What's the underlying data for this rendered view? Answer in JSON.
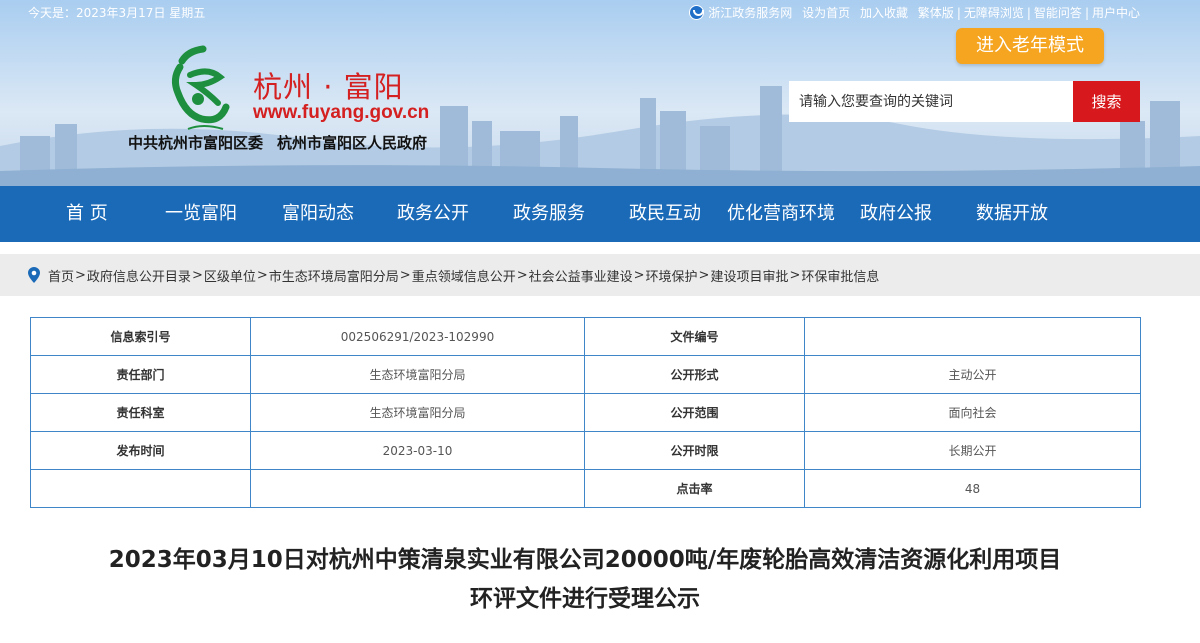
{
  "topbar": {
    "date": "今天是：2023年3月17日 星期五",
    "links": [
      "浙江政务服务网",
      "设为首页",
      "加入收藏",
      "繁体版",
      "无障碍浏览",
      "智能问答",
      "用户中心"
    ]
  },
  "elder_mode": "进入老年模式",
  "logo": {
    "title": "杭州 · 富阳",
    "url": "www.fuyang.gov.cn",
    "org1": "中共杭州市富阳区委",
    "org2": "杭州市富阳区人民政府"
  },
  "search": {
    "placeholder": "请输入您要查询的关键词",
    "button": "搜索"
  },
  "nav": [
    "首 页",
    "一览富阳",
    "富阳动态",
    "政务公开",
    "政务服务",
    "政民互动",
    "优化营商环境",
    "政府公报",
    "数据开放"
  ],
  "breadcrumb": [
    "首页",
    "政府信息公开目录",
    "区级单位",
    "市生态环境局富阳分局",
    "重点领域信息公开",
    "社会公益事业建设",
    "环境保护",
    "建设项目审批",
    "环保审批信息"
  ],
  "info_table": {
    "rows": [
      {
        "k1": "信息索引号",
        "v1": "002506291/2023-102990",
        "k2": "文件编号",
        "v2": ""
      },
      {
        "k1": "责任部门",
        "v1": "生态环境富阳分局",
        "k2": "公开形式",
        "v2": "主动公开"
      },
      {
        "k1": "责任科室",
        "v1": "生态环境富阳分局",
        "k2": "公开范围",
        "v2": "面向社会"
      },
      {
        "k1": "发布时间",
        "v1": "2023-03-10",
        "k2": "公开时限",
        "v2": "长期公开"
      },
      {
        "k1": "",
        "v1": "",
        "k2": "点击率",
        "v2": "48"
      }
    ]
  },
  "article": {
    "title_line1": "2023年03月10日对杭州中策清泉实业有限公司20000吨/年废轮胎高效清洁资源化利用项目",
    "title_line2": "环评文件进行受理公示"
  },
  "colors": {
    "nav_bg": "#1a6ab8",
    "search_btn": "#d7181c",
    "elder_btn": "#f5a520",
    "brand_red": "#d42020",
    "table_border": "#3e86c8"
  }
}
